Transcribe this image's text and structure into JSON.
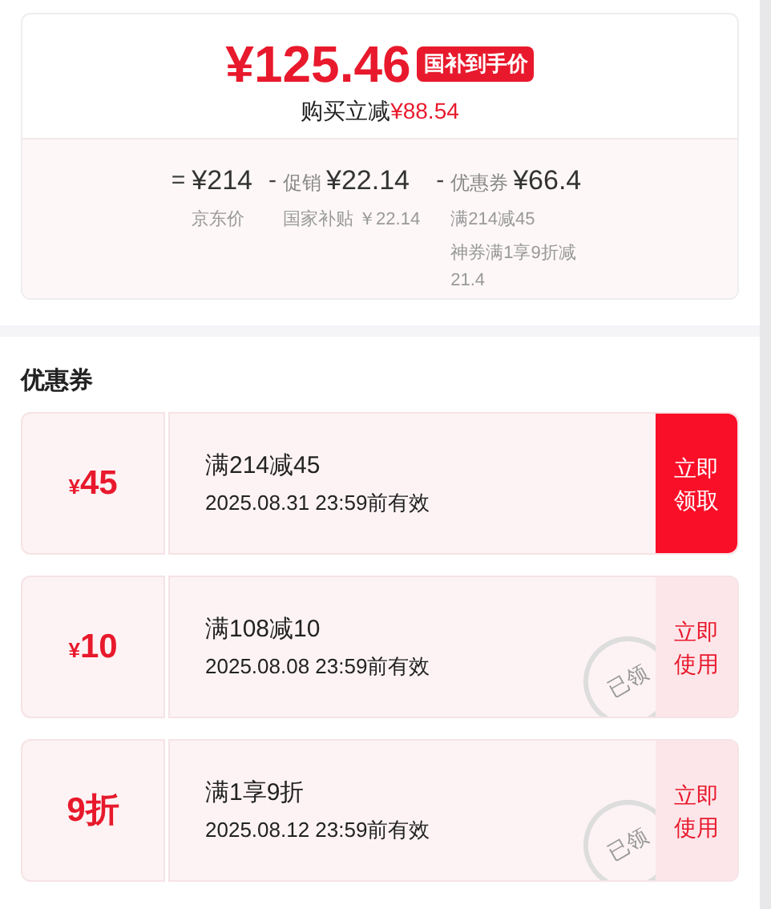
{
  "summary": {
    "price": "¥125.46",
    "badge": "国补到手价",
    "saving_label": "购买立减",
    "saving_amount": "¥88.54"
  },
  "breakdown": [
    {
      "operator": "=",
      "amount": "¥214",
      "notes": [
        "京东价"
      ]
    },
    {
      "operator": "-",
      "name": "促销",
      "amount": "¥22.14",
      "notes": [
        "国家补贴 ￥22.14"
      ]
    },
    {
      "operator": "-",
      "name": "优惠券",
      "amount": "¥66.4",
      "notes": [
        "满214减45",
        "神券满1享9折减21.4"
      ]
    }
  ],
  "coupons_title": "优惠券",
  "coupons": [
    {
      "currency": "¥",
      "value": "45",
      "title": "满214减45",
      "validity": "2025.08.31 23:59前有效",
      "action": "立即领取",
      "claimed": false
    },
    {
      "currency": "¥",
      "value": "10",
      "title": "满108减10",
      "validity": "2025.08.08 23:59前有效",
      "action": "立即使用",
      "claimed": true,
      "stamp": "已领"
    },
    {
      "value": "9折",
      "title": "满1享9折",
      "validity": "2025.08.12 23:59前有效",
      "action": "立即使用",
      "claimed": true,
      "stamp": "已领"
    }
  ]
}
